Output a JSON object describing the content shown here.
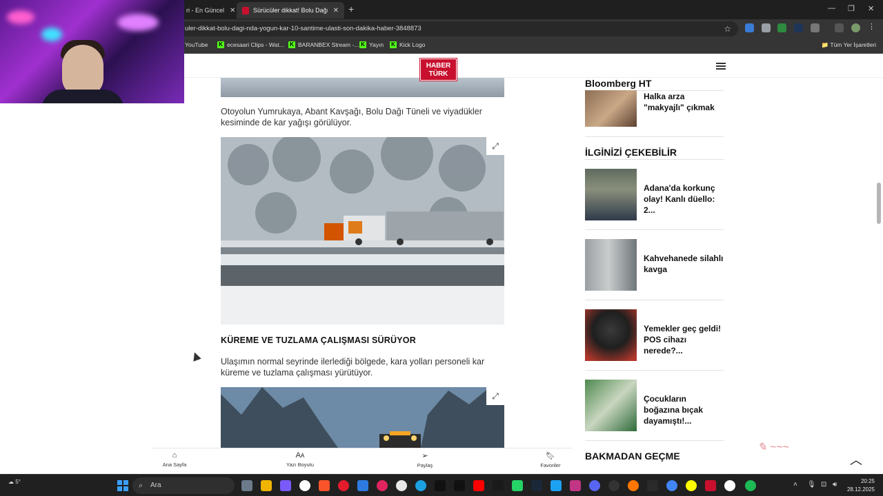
{
  "browser": {
    "tabs": [
      {
        "label": "ri - En Güncel",
        "active": false
      },
      {
        "label": "Sürücüler dikkat! Bolu Dağı'nda",
        "active": true
      }
    ],
    "new_tab": "+",
    "window_controls": [
      "—",
      "❐",
      "✕"
    ],
    "url": "uler-dikkat-bolu-dagi-nda-yogun-kar-10-santime-ulasti-son-dakika-haber-3848873",
    "bookmarks": [
      "YouTube",
      "ecesaari Clips - Wat...",
      "BARANBEX Stream -...",
      "Yayın",
      "Kick Logo"
    ],
    "bookmarks_all": "Tüm Yer İşaretleri"
  },
  "site": {
    "logo_line1": "HABER",
    "logo_line2": "TÜRK"
  },
  "article": {
    "para1": "Otoyolun Yumrukaya, Abant Kavşağı, Bolu Dağı Tüneli ve viyadükler kesiminde de kar yağışı görülüyor.",
    "subhead": "KÜREME VE TUZLAMA ÇALIŞMASI SÜRÜYOR",
    "para2": "Ulaşımın normal seyrinde ilerlediği bölgede, kara yolları personeli kar küreme ve tuzlama çalışması yürütüyor.",
    "expand_icon": "expand-icon"
  },
  "sidebar": {
    "bloomberg_title": "Bloomberg HT",
    "bloomberg_item": "Halka arza \"makyajlı\" çıkmak",
    "interest_title": "İLGİNİZİ ÇEKEBİLİR",
    "items": [
      {
        "title": "Adana'da korkunç olay! Kanlı düello: 2..."
      },
      {
        "title": "Kahvehanede silahlı kavga"
      },
      {
        "title": "Yemekler geç geldi! POS cihazı nerede?..."
      },
      {
        "title": "Çocukların boğazına bıçak dayamıştı!..."
      }
    ],
    "dont_miss_title": "BAKMADAN GEÇME"
  },
  "actionbar": [
    {
      "label": "Ana Sayfa",
      "icon": "home-icon"
    },
    {
      "label": "Yazı Boyutu",
      "icon": "font-size-icon"
    },
    {
      "label": "Paylaş",
      "icon": "share-icon"
    },
    {
      "label": "Favoriler",
      "icon": "bookmark-icon"
    }
  ],
  "taskbar": {
    "weather": "5°",
    "search_placeholder": "Ara",
    "time": "20:25",
    "date": "28.12.2025"
  }
}
